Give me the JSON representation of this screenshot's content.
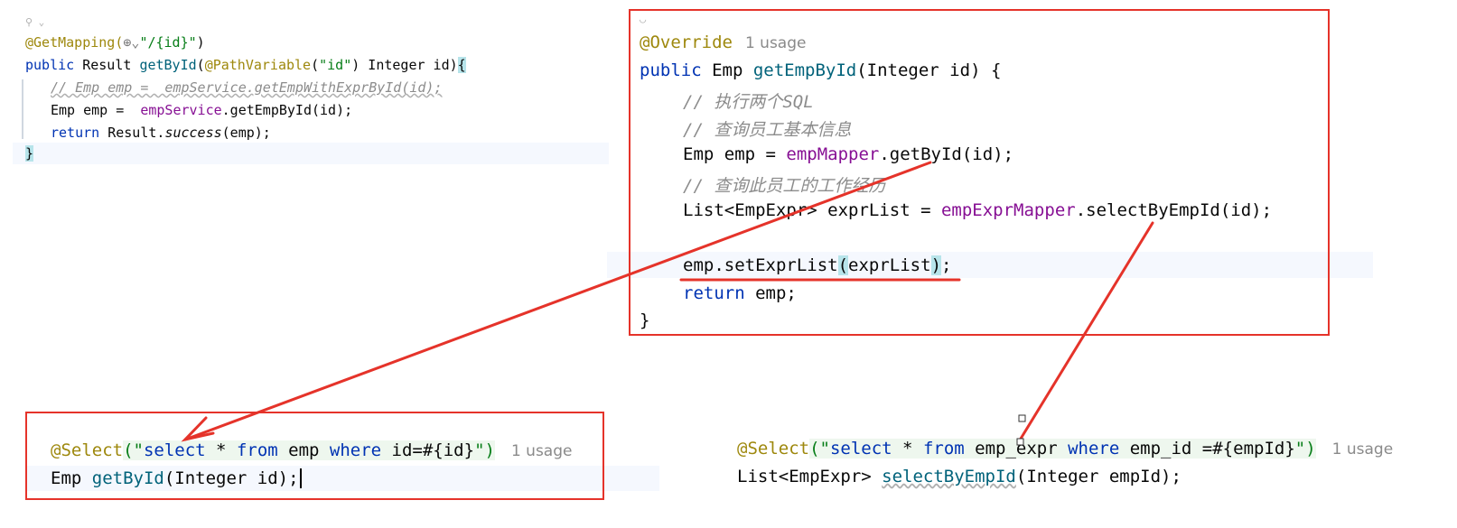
{
  "controller": {
    "gutter_hint": "⚲ ⌄",
    "line1": {
      "annotation": "@GetMapping(",
      "globe": "⊕",
      "chev": "⌄",
      "path": "\"/{id}\"",
      "close": ")"
    },
    "line2": {
      "kw": "public",
      "type": " Result ",
      "method": "getById",
      "open": "(",
      "annotation": "@PathVariable",
      "argopen": "(",
      "argstr": "\"id\"",
      "rest": ") Integer id)",
      "brace": "{"
    },
    "line3": "// Emp emp =  empService.getEmpWithExprById(id);",
    "line4": {
      "a": "Emp emp =  ",
      "field": "empService",
      "b": ".getEmpById(id);"
    },
    "line5": {
      "kw": "return",
      "a": " Result.",
      "method": "success",
      "b": "(emp);"
    },
    "line6": "}"
  },
  "service": {
    "hint": "◡",
    "line1": {
      "annotation": "@Override",
      "usage": "1 usage"
    },
    "line2": {
      "kw": "public",
      "a": " Emp ",
      "method": "getEmpById",
      "b": "(Integer id) {"
    },
    "line3": "// 执行两个SQL",
    "line4": "// 查询员工基本信息",
    "line5": {
      "a": "Emp emp = ",
      "field": "empMapper",
      "b": ".getById(id);"
    },
    "line6": "// 查询此员工的工作经历",
    "line7": {
      "a": "List<EmpExpr> exprList = ",
      "field": "empExprMapper",
      "b": ".selectByEmpId(id);"
    },
    "line8": {
      "a": "emp.setExprList",
      "open": "(",
      "arg": "exprList",
      "close": ")",
      "b": ";"
    },
    "line9": {
      "kw": "return",
      "a": " emp;"
    },
    "line10": "}"
  },
  "mapper_emp": {
    "line1": {
      "annotation": "@Select",
      "open": "(\"",
      "s1": "select",
      "s2": " * ",
      "s3": "from",
      "s4": " emp ",
      "s5": "where",
      "s6": " id=#{id}",
      "close": "\")",
      "usage": "1 usage"
    },
    "line2": {
      "a": "Emp ",
      "method": "getById",
      "b": "(Integer id);"
    }
  },
  "mapper_expr": {
    "line1": {
      "annotation": "@Select",
      "open": "(\"",
      "s1": "select",
      "s2": " * ",
      "s3": "from",
      "s4": " emp_expr ",
      "s5": "where",
      "s6": " emp_id =#{empId}",
      "close": "\")",
      "usage": "1 usage"
    },
    "line2": {
      "a": "List<EmpExpr> ",
      "method": "selectByEmpId",
      "b": "(Integer empId);"
    }
  },
  "colors": {
    "annotation_box": "#e5332a",
    "arrow": "#e5332a"
  }
}
